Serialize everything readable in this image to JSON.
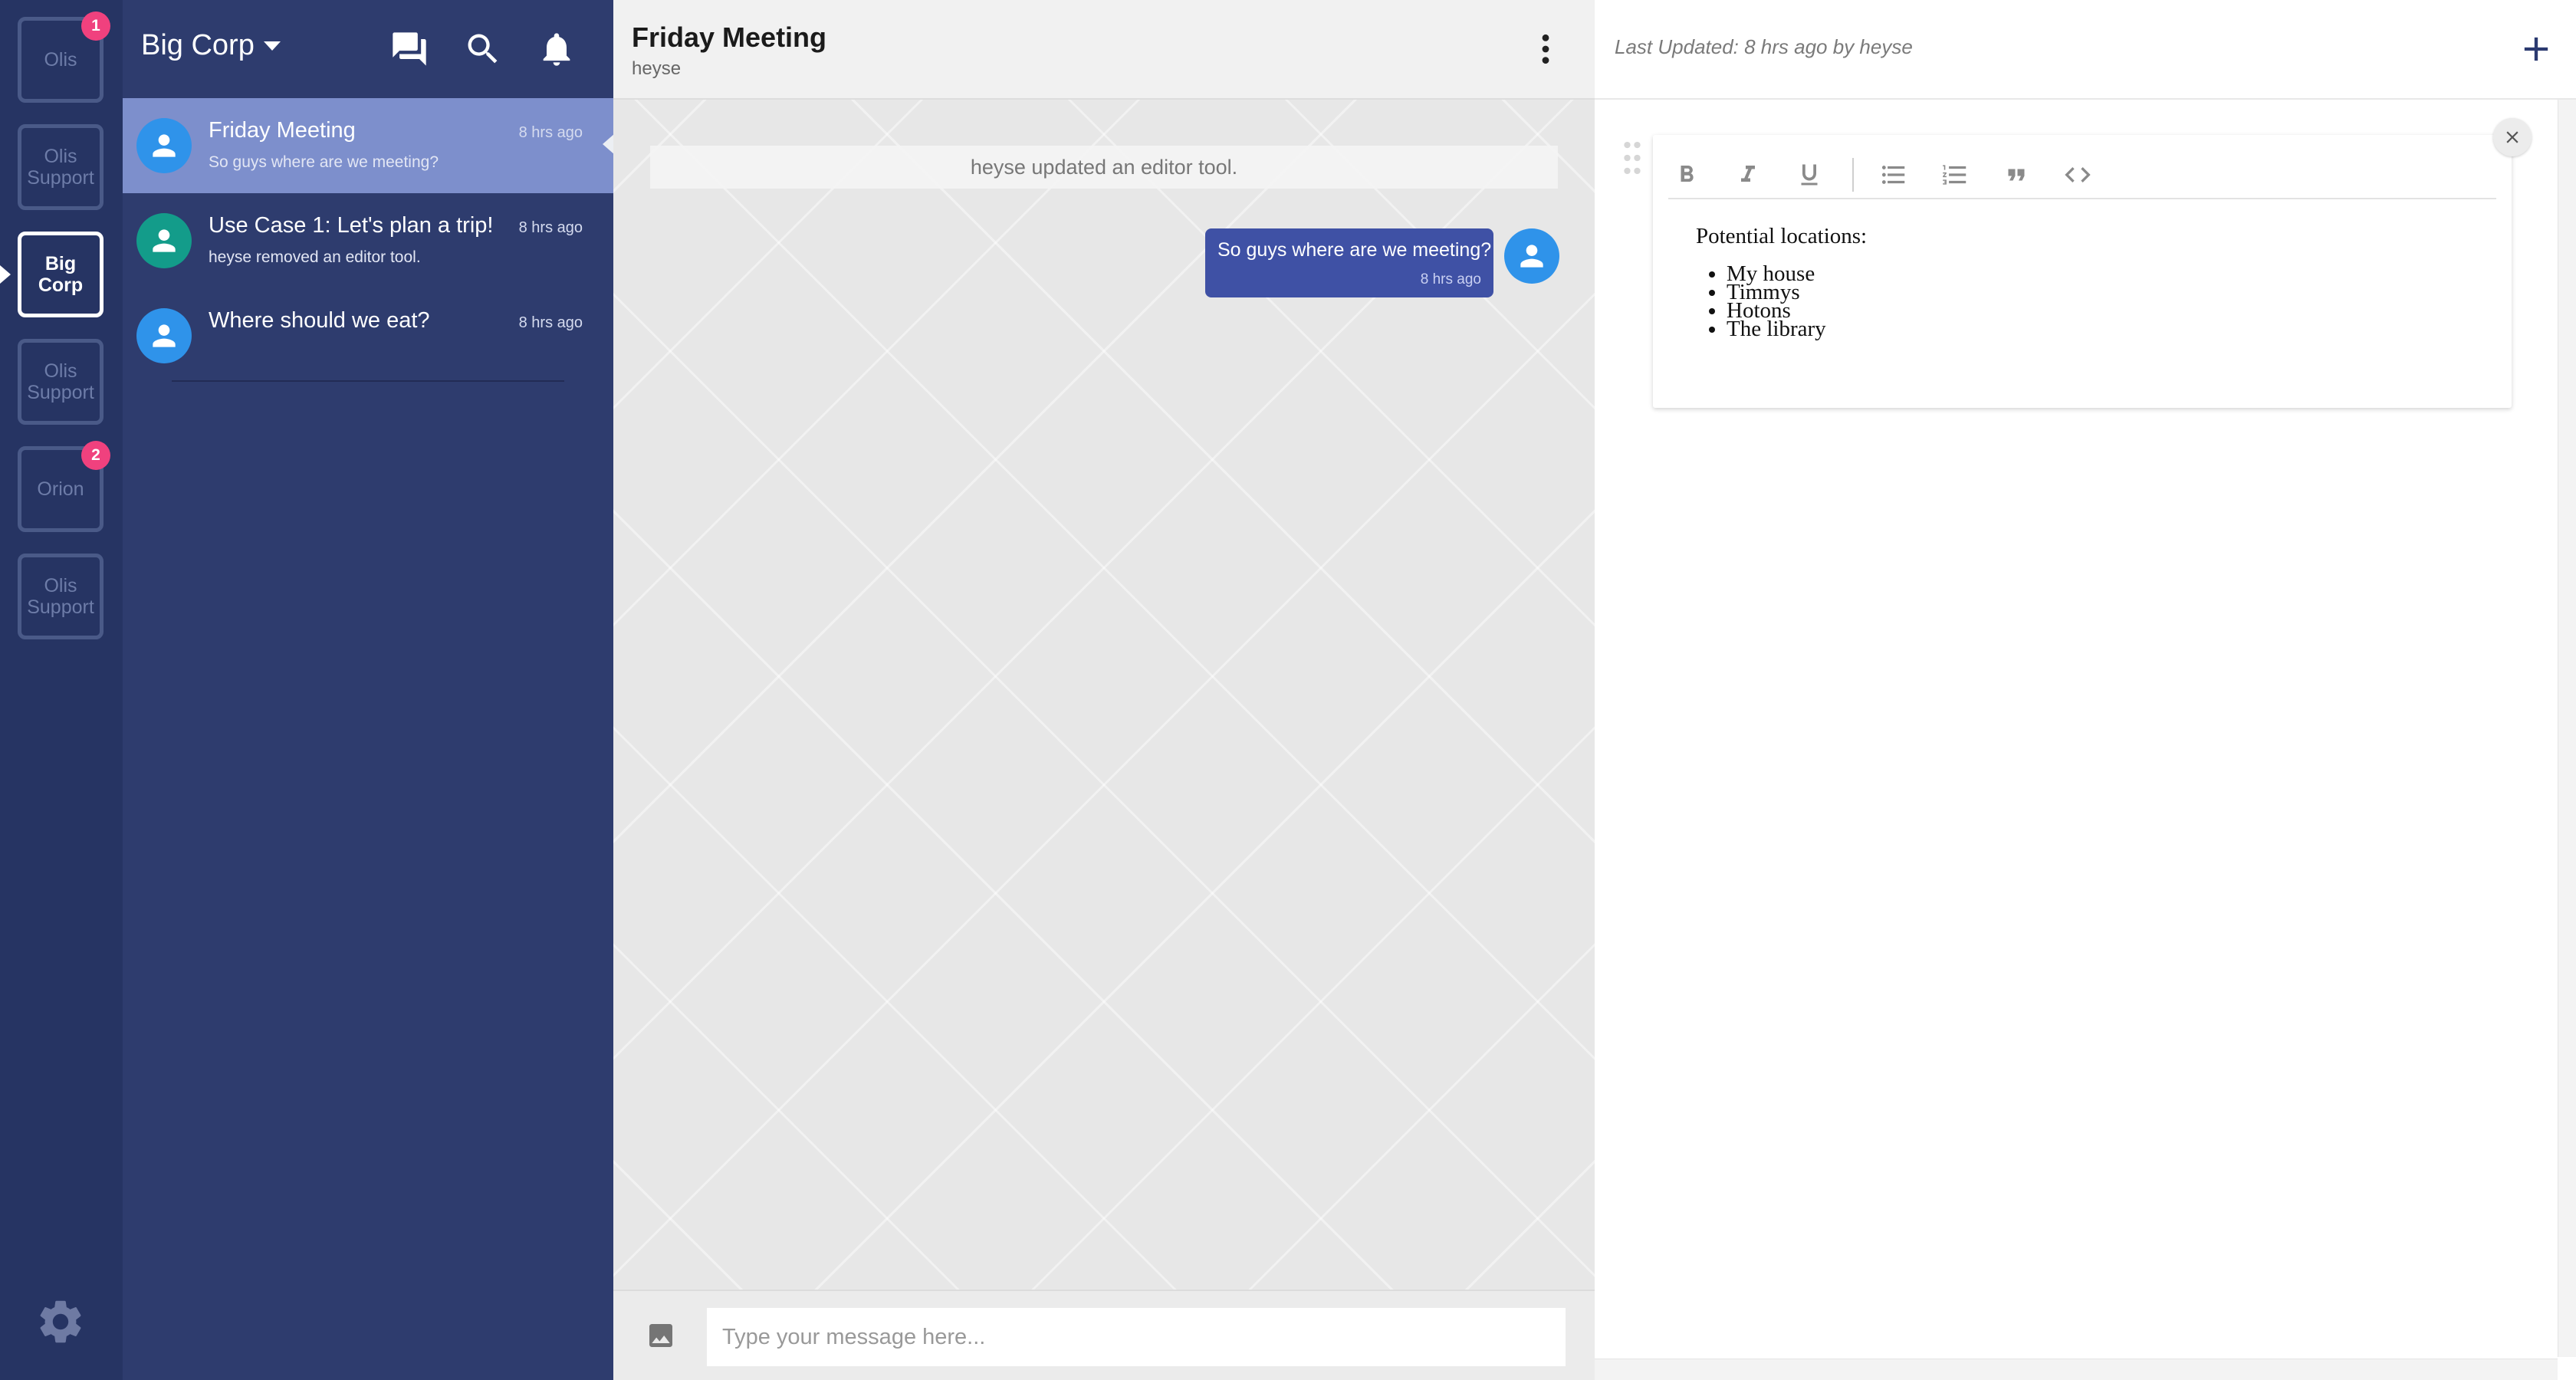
{
  "workspaces": [
    {
      "label": "Olis",
      "badge": "1",
      "active": false
    },
    {
      "label": "Olis Support",
      "badge": "",
      "active": false
    },
    {
      "label": "Big Corp",
      "badge": "",
      "active": true
    },
    {
      "label": "Olis Support",
      "badge": "",
      "active": false
    },
    {
      "label": "Orion",
      "badge": "2",
      "active": false
    },
    {
      "label": "Olis Support",
      "badge": "",
      "active": false
    }
  ],
  "org": {
    "name": "Big Corp"
  },
  "header_icons": [
    "chat-icon",
    "search-icon",
    "bell-icon"
  ],
  "conversations": [
    {
      "title": "Friday Meeting",
      "time": "8 hrs ago",
      "subtitle": "So guys where are we meeting?",
      "avatar_color": "#2f93ea",
      "selected": true
    },
    {
      "title": "Use Case 1: Let's plan a trip!",
      "time": "8 hrs ago",
      "subtitle": "heyse removed an editor tool.",
      "avatar_color": "#139c8a",
      "selected": false
    },
    {
      "title": "Where should we eat?",
      "time": "8 hrs ago",
      "subtitle": "",
      "avatar_color": "#2f93ea",
      "selected": false
    }
  ],
  "chat": {
    "title": "Friday Meeting",
    "subtitle": "heyse",
    "system_message": "heyse updated an editor tool.",
    "message": {
      "text": "So guys where are we meeting?",
      "time": "8 hrs ago"
    },
    "input_placeholder": "Type your message here..."
  },
  "editor": {
    "last_updated": "Last Updated: 8 hrs ago by heyse",
    "toolbar": [
      "bold-icon",
      "italic-icon",
      "underline-icon",
      "bulleted-list-icon",
      "numbered-list-icon",
      "quote-icon",
      "code-icon"
    ],
    "heading": "Potential locations:",
    "items": [
      "My house",
      "Timmys",
      "Hotons",
      "The library"
    ]
  },
  "colors": {
    "rail": "#263463",
    "conversation_list": "#2e3c6e",
    "selected_conversation": "#7d8fcc",
    "message_bubble": "#3f51a5",
    "badge": "#f0417e"
  }
}
